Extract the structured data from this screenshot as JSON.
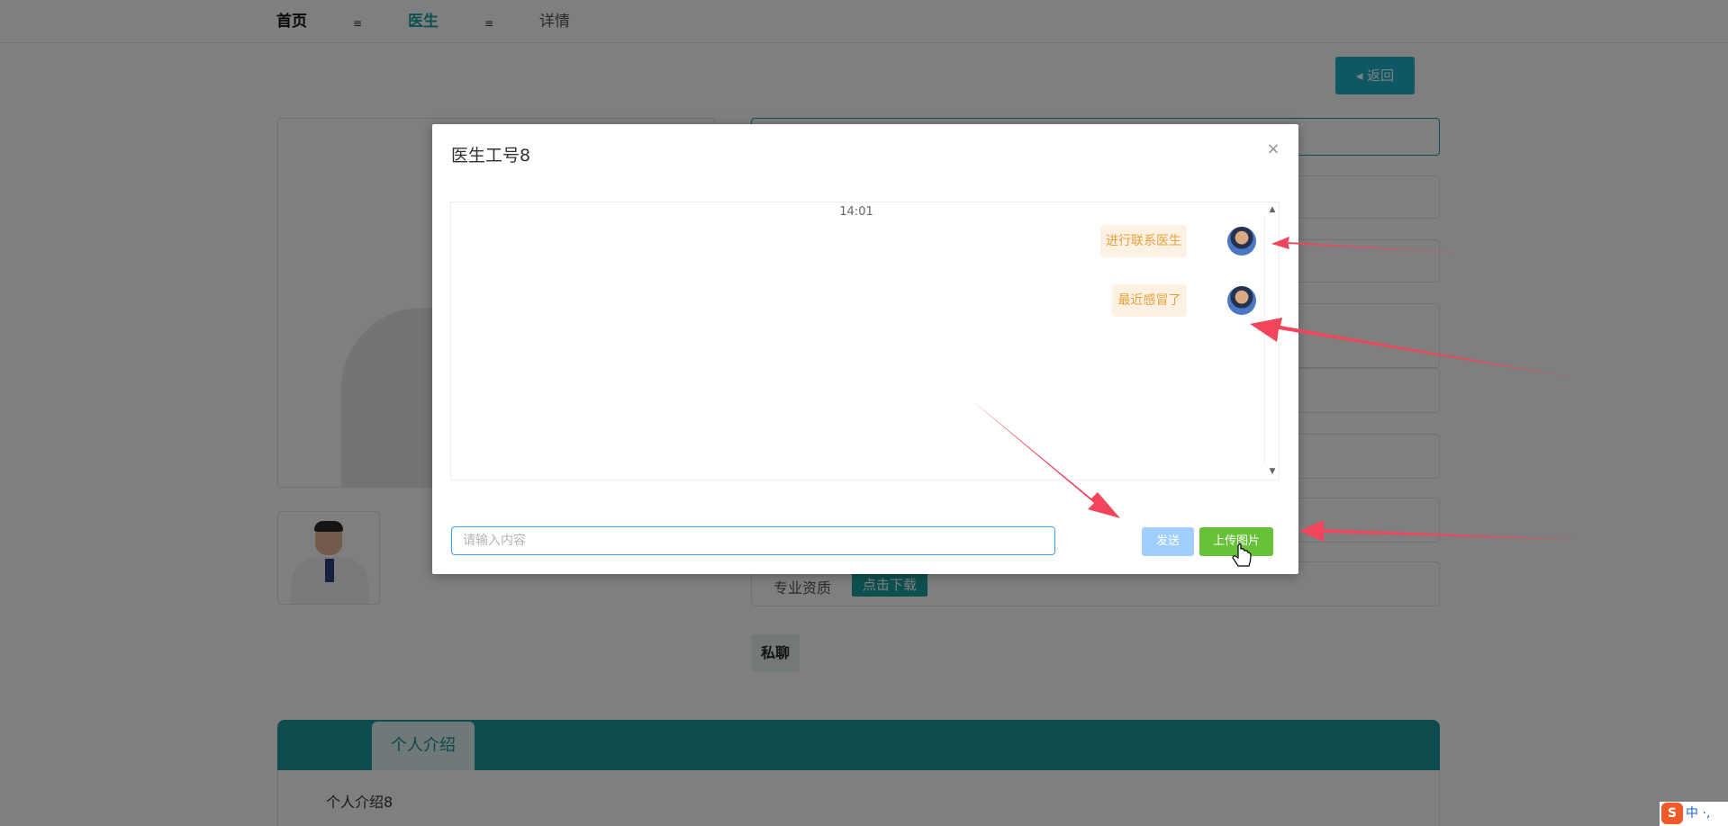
{
  "nav": {
    "home": "首页",
    "separator": "≡",
    "doctor": "医生",
    "detail": "详情"
  },
  "page": {
    "back_label": "◂ 返回",
    "qualification_label": "专业资质",
    "download_label": "点击下载",
    "private_chat_label": "私聊",
    "tab_label": "个人介绍",
    "intro_text": "个人介绍8"
  },
  "modal": {
    "title": "医生工号8",
    "close": "×",
    "time": "14:01",
    "scroll_up": "▲",
    "scroll_down": "▼",
    "messages": [
      {
        "text": "进行联系医生"
      },
      {
        "text": "最近感冒了"
      }
    ],
    "input_placeholder": "请输入内容",
    "send_label": "发送",
    "upload_label": "上传图片"
  },
  "ime": {
    "logo": "S",
    "mode": "中 ·,"
  },
  "colors": {
    "accent": "#1aa0a0",
    "upload_green": "#67c23a",
    "send_blue": "#a0cfff",
    "bubble_bg": "#fdf1e3",
    "bubble_text": "#e6a23c",
    "arrow_red": "#f2445a"
  }
}
